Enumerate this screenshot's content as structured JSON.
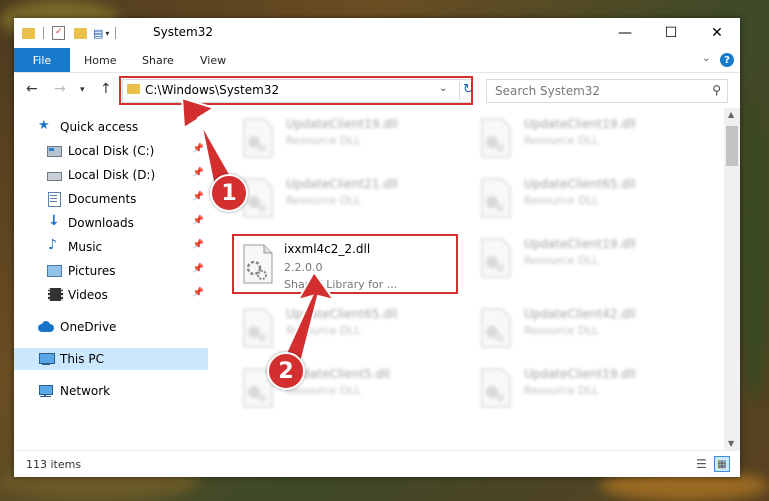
{
  "window": {
    "title": "System32",
    "minimize": "—",
    "maximize": "☐",
    "close": "✕"
  },
  "ribbon": {
    "file": "File",
    "home": "Home",
    "share": "Share",
    "view": "View",
    "help": "?"
  },
  "address": {
    "path": "C:\\Windows\\System32",
    "search_placeholder": "Search System32"
  },
  "sidebar": {
    "items": [
      {
        "label": "Quick access"
      },
      {
        "label": "Local Disk (C:)"
      },
      {
        "label": "Local Disk (D:)"
      },
      {
        "label": "Documents"
      },
      {
        "label": "Downloads"
      },
      {
        "label": "Music"
      },
      {
        "label": "Pictures"
      },
      {
        "label": "Videos"
      },
      {
        "label": "OneDrive"
      },
      {
        "label": "This PC"
      },
      {
        "label": "Network"
      }
    ]
  },
  "files": {
    "left": [
      {
        "name": "UpdateClient19.dll",
        "desc": "Resource DLL"
      },
      {
        "name": "UpdateClient21.dll",
        "desc": "Resource DLL"
      },
      {
        "name": "ixxml4c2_2.dll",
        "desc": "2.2.0.0",
        "desc2": "Shared Library for ..."
      },
      {
        "name": "UpdateClient65.dll",
        "desc": "Resource DLL"
      },
      {
        "name": "UpdateClient5.dll",
        "desc": "Resource DLL"
      }
    ],
    "right": [
      {
        "name": "UpdateClient19.dll",
        "desc": "Resource DLL"
      },
      {
        "name": "UpdateClient65.dll",
        "desc": "Resource DLL"
      },
      {
        "name": "UpdateClient19.dll",
        "desc": "Resource DLL"
      },
      {
        "name": "UpdateClient42.dll",
        "desc": "Resource DLL"
      },
      {
        "name": "UpdateClient19.dll",
        "desc": "Resource DLL"
      }
    ]
  },
  "status": {
    "count": "113 items"
  },
  "callouts": {
    "one": "1",
    "two": "2"
  },
  "colors": {
    "accent": "#1979ca",
    "annotation": "#d32f2f",
    "selected": "#cce8ff"
  }
}
